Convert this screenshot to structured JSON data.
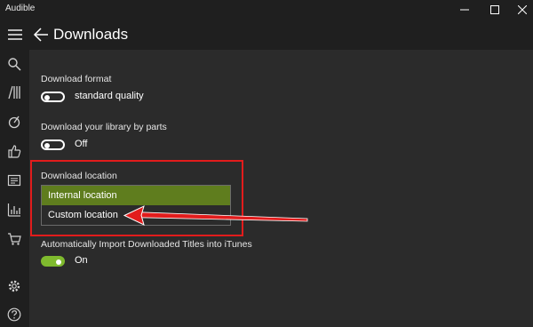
{
  "app": {
    "title": "Audible"
  },
  "header": {
    "title": "Downloads"
  },
  "settings": {
    "format": {
      "label": "Download format",
      "toggle_text": "standard quality",
      "on": false
    },
    "parts": {
      "label": "Download your library by parts",
      "toggle_text": "Off",
      "on": false
    },
    "location": {
      "label": "Download location",
      "options": [
        "Internal location",
        "Custom location"
      ],
      "selected": "Internal location"
    },
    "itunes": {
      "label": "Automatically Import Downloaded Titles into iTunes",
      "toggle_text": "On",
      "on": true
    }
  },
  "sidebar": {
    "icons": [
      "search-icon",
      "library-icon",
      "discover-icon",
      "thumbs-up-icon",
      "notes-icon",
      "stats-icon",
      "cart-icon",
      "settings-icon",
      "help-icon"
    ]
  },
  "colors": {
    "accent": "#7fba2e",
    "selected": "#5f7d1e",
    "annotation": "#e21c1c",
    "background": "#2b2b2b",
    "chrome": "#1f1f1f"
  }
}
